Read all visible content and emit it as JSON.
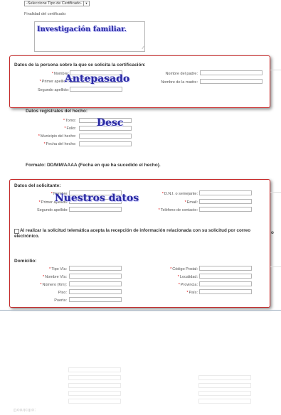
{
  "cert_type": {
    "selected": "-Seleccione Tipo de Certificado-"
  },
  "finalidad": {
    "label": "Finalidad del certificado:",
    "overlay": "Investigación familiar."
  },
  "persona": {
    "title": "Datos de la persona sobre la que se solicita la certificación:",
    "overlay": "Antepasado",
    "nombre": "Nombre:",
    "primer_apellido": "Primer apellido:",
    "segundo_apellido": "Segundo apellido:",
    "nombre_padre": "Nombre del padre:",
    "nombre_madre": "Nombre de la madre:",
    "req": "*"
  },
  "registrales": {
    "title": "Datos registrales del hecho:",
    "overlay": "Desc",
    "tomo": "Tomo:",
    "folio": "Folio:",
    "municipio": "Municipio del hecho:",
    "fecha": "Fecha del hecho:",
    "formato": "Formato: DD/MM/AAAA (Fecha en que ha sucedido el hecho)."
  },
  "solicitante": {
    "title": "Datos del solicitante:",
    "overlay": "Nuestros datos",
    "nombre": "Nombre:",
    "primer_apellido": "Primer apellido:",
    "segundo_apellido": "Segundo apellido:",
    "dni": "D.N.I. o semejante:",
    "email": "Email:",
    "telefono": "Teléfono de contacto:",
    "consent": "Al realizar la solicitud telemática acepta la recepción de información relacionada con su solicitud por correo electrónico.",
    "consent_tail": "o"
  },
  "domicilio": {
    "title": "Domicilio:",
    "tipo_via": "Tipo Vía:",
    "nombre_via": "Nombre Vía:",
    "numero": "Número (Km):",
    "piso": "Piso:",
    "puerta": "Puerta:",
    "codigo_postal": "Código Postal:",
    "localidad": "Localidad:",
    "provincia": "Provincia:",
    "pais": "País:"
  }
}
